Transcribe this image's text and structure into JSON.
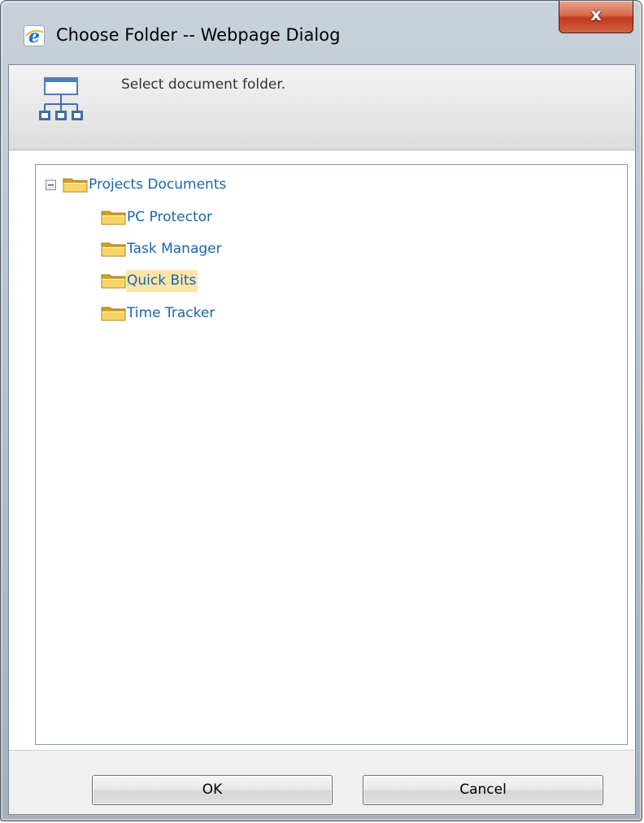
{
  "window": {
    "title": "Choose Folder -- Webpage Dialog",
    "close_glyph": "x",
    "icon": "ie-icon"
  },
  "header": {
    "icon": "sitemap-icon",
    "text": "Select document folder."
  },
  "tree": {
    "root": {
      "label": "Projects Documents",
      "expanded": true,
      "icon": "folder-icon"
    },
    "children": [
      {
        "label": "PC Protector",
        "selected": false,
        "icon": "folder-icon"
      },
      {
        "label": "Task Manager",
        "selected": false,
        "icon": "folder-icon"
      },
      {
        "label": "Quick Bits",
        "selected": true,
        "icon": "folder-icon"
      },
      {
        "label": "Time Tracker",
        "selected": false,
        "icon": "folder-icon"
      }
    ]
  },
  "buttons": {
    "ok_label": "OK",
    "cancel_label": "Cancel"
  },
  "colors": {
    "link": "#1666b2",
    "selection": "#fde5a7",
    "close_button": "#c2371d",
    "panel_border": "#7e9ab6"
  }
}
